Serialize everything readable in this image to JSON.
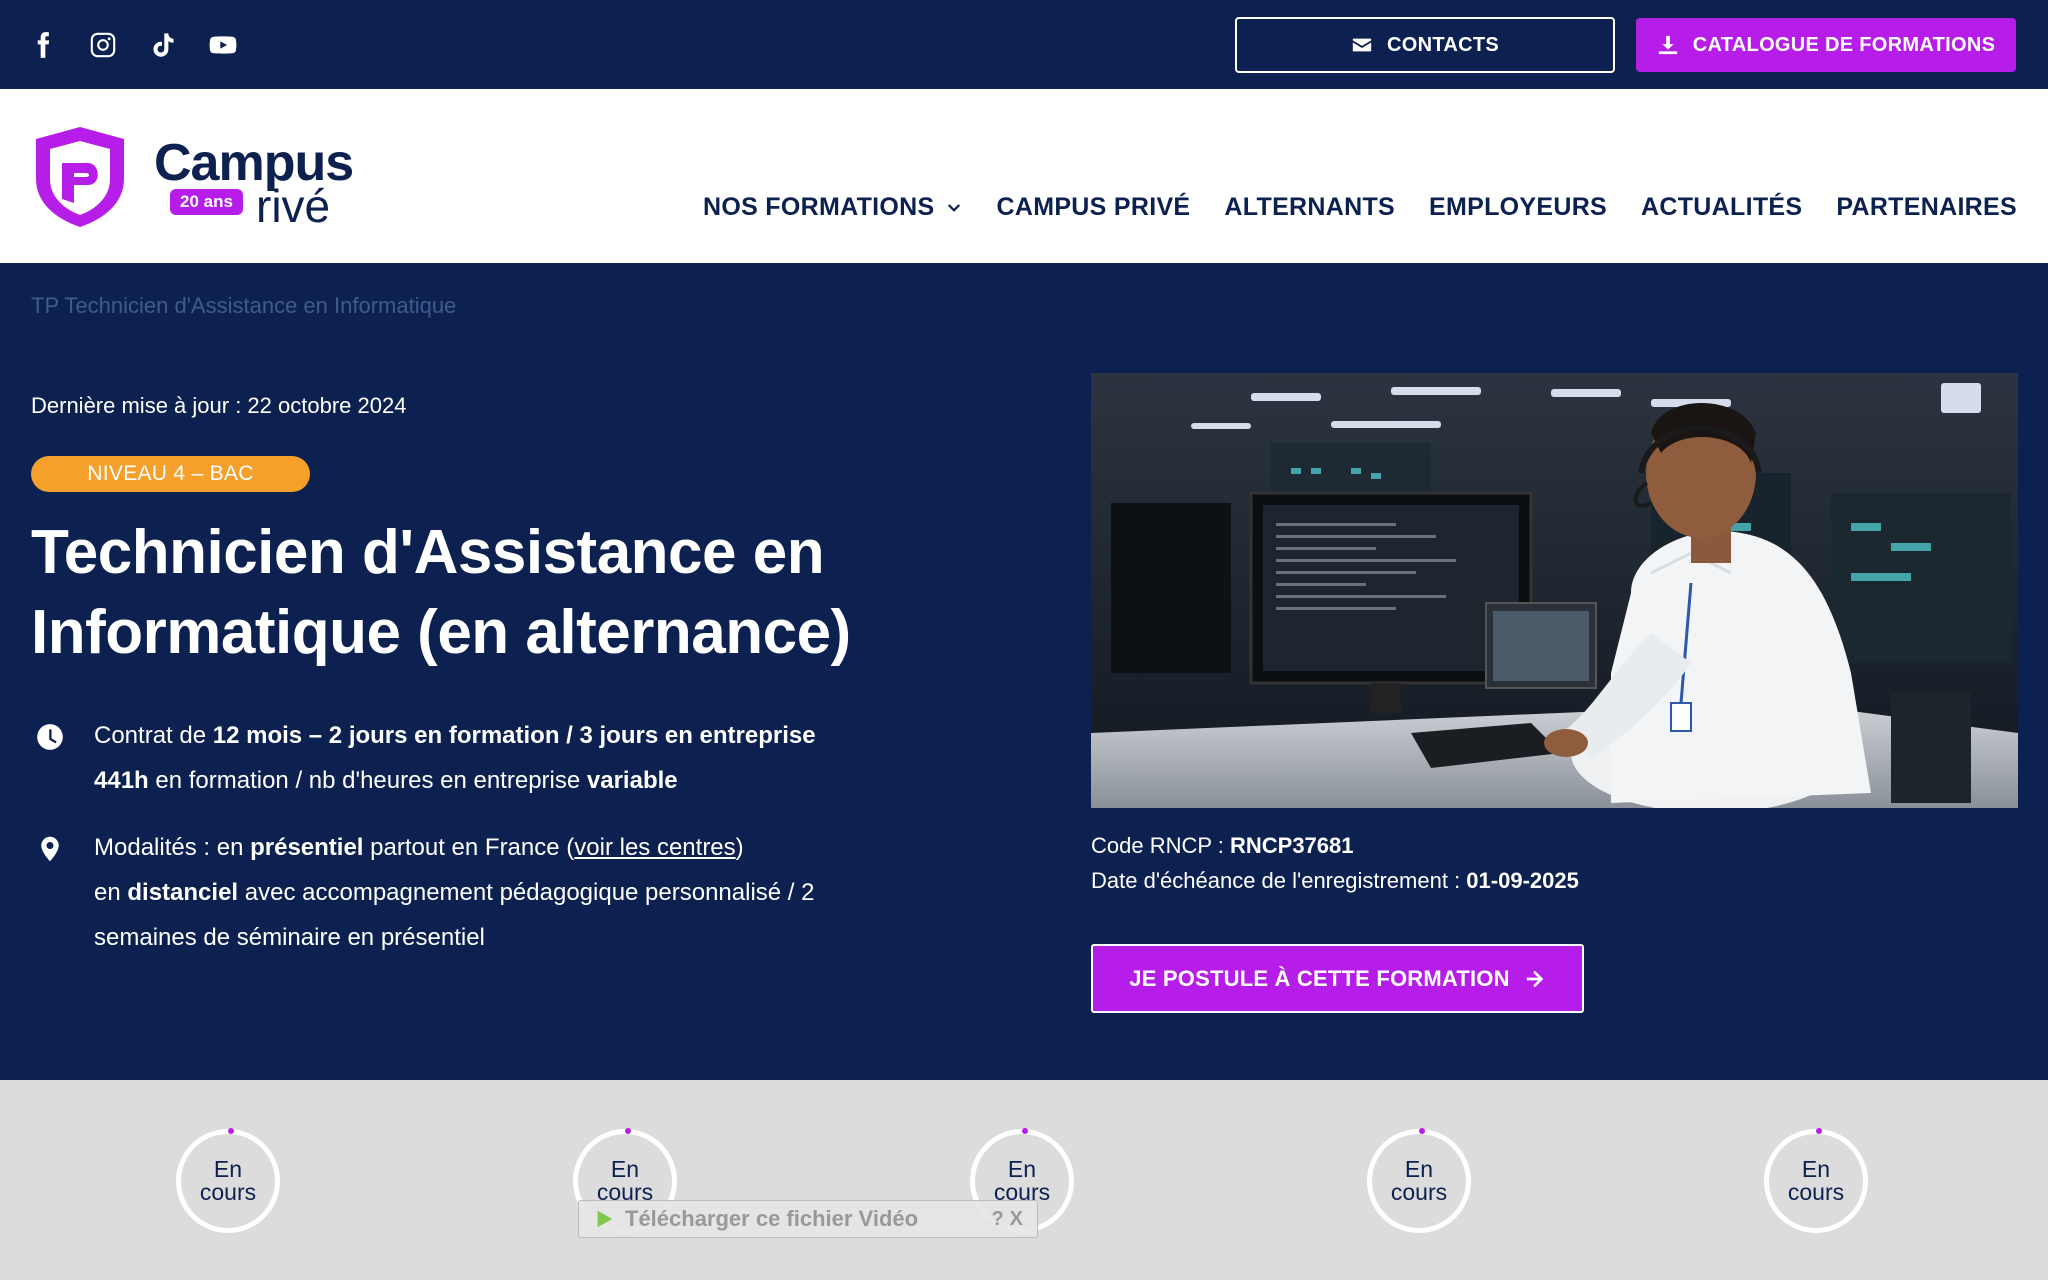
{
  "topbar": {
    "socials": [
      "facebook-icon",
      "instagram-icon",
      "tiktok-icon",
      "youtube-icon"
    ],
    "contacts_label": "CONTACTS",
    "catalogue_label": "CATALOGUE DE FORMATIONS"
  },
  "header": {
    "logo": {
      "name": "Campus",
      "suffix": "rivé",
      "badge": "20 ans"
    },
    "nav": [
      {
        "label": "NOS FORMATIONS",
        "has_dropdown": true
      },
      {
        "label": "CAMPUS PRIVÉ"
      },
      {
        "label": "ALTERNANTS"
      },
      {
        "label": "EMPLOYEURS"
      },
      {
        "label": "ACTUALITÉS"
      },
      {
        "label": "PARTENAIRES"
      }
    ]
  },
  "hero": {
    "breadcrumb": "TP Technicien d'Assistance en Informatique",
    "updated": "Dernière mise à jour : 22 octobre 2024",
    "level": "NIVEAU 4 – BAC",
    "title_line1": "Technicien d'Assistance en",
    "title_line2": "Informatique (en alternance)",
    "contract": {
      "prefix": "Contrat de ",
      "bold": "12 mois – 2 jours en formation / 3 jours en entreprise",
      "hours_bold": "441h",
      "hours_text": " en formation / nb d'heures en entreprise ",
      "hours_variable": "variable"
    },
    "modalities": {
      "prefix": "Modalités : en ",
      "presentiel": "présentiel",
      "middle": " partout en France (",
      "link": "voir les centres",
      "close": ")",
      "line2_prefix": "en ",
      "distanciel": "distanciel",
      "line2_rest": " avec accompagnement pédagogique personnalisé / 2",
      "line3": "semaines de séminaire en présentiel"
    },
    "rncp_label": "Code RNCP : ",
    "rncp_value": "RNCP37681",
    "expiry_label": "Date d'échéance de l'enregistrement : ",
    "expiry_value": "01-09-2025",
    "apply_label": "JE POSTULE À CETTE FORMATION"
  },
  "stats": [
    {
      "line1": "En",
      "line2": "cours"
    },
    {
      "line1": "En",
      "line2": "cours"
    },
    {
      "line1": "En",
      "line2": "cours"
    },
    {
      "line1": "En",
      "line2": "cours"
    },
    {
      "line1": "En",
      "line2": "cours"
    }
  ],
  "video_bar": {
    "label": "Télécharger ce fichier Vidéo",
    "help": "?",
    "close": "X"
  },
  "colors": {
    "navy": "#0d2150",
    "purple": "#b61de8",
    "orange": "#f5a02a"
  }
}
